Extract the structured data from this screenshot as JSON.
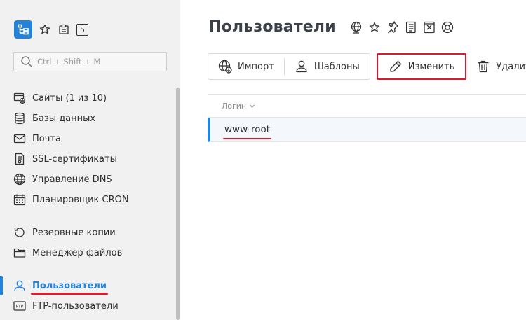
{
  "sidebar": {
    "search": {
      "placeholder": "Ctrl + Shift + M",
      "value": ""
    },
    "badge": "5",
    "items": [
      {
        "label": "Сайты (1 из 10)",
        "icon": "sites-icon"
      },
      {
        "label": "Базы данных",
        "icon": "database-icon"
      },
      {
        "label": "Почта",
        "icon": "mail-icon"
      },
      {
        "label": "SSL-сертификаты",
        "icon": "certificate-icon"
      },
      {
        "label": "Управление DNS",
        "icon": "globe-icon"
      },
      {
        "label": "Планировщик CRON",
        "icon": "calendar-icon"
      },
      {
        "label": "Резервные копии",
        "icon": "backup-icon"
      },
      {
        "label": "Менеджер файлов",
        "icon": "folder-icon"
      },
      {
        "label": "Пользователи",
        "icon": "user-icon",
        "active": true
      },
      {
        "label": "FTP-пользователи",
        "icon": "ftp-icon"
      }
    ]
  },
  "main": {
    "title": "Пользователи",
    "toolbar": {
      "import_label": "Импорт",
      "templates_label": "Шаблоны",
      "edit_label": "Изменить",
      "delete_label": "Удалить"
    },
    "table": {
      "columns": [
        "Логин"
      ],
      "rows": [
        {
          "login": "www-root"
        }
      ]
    }
  },
  "colors": {
    "accent": "#2483d8",
    "highlight": "#e0182b",
    "sidebar_bg": "#f1f1f1"
  }
}
